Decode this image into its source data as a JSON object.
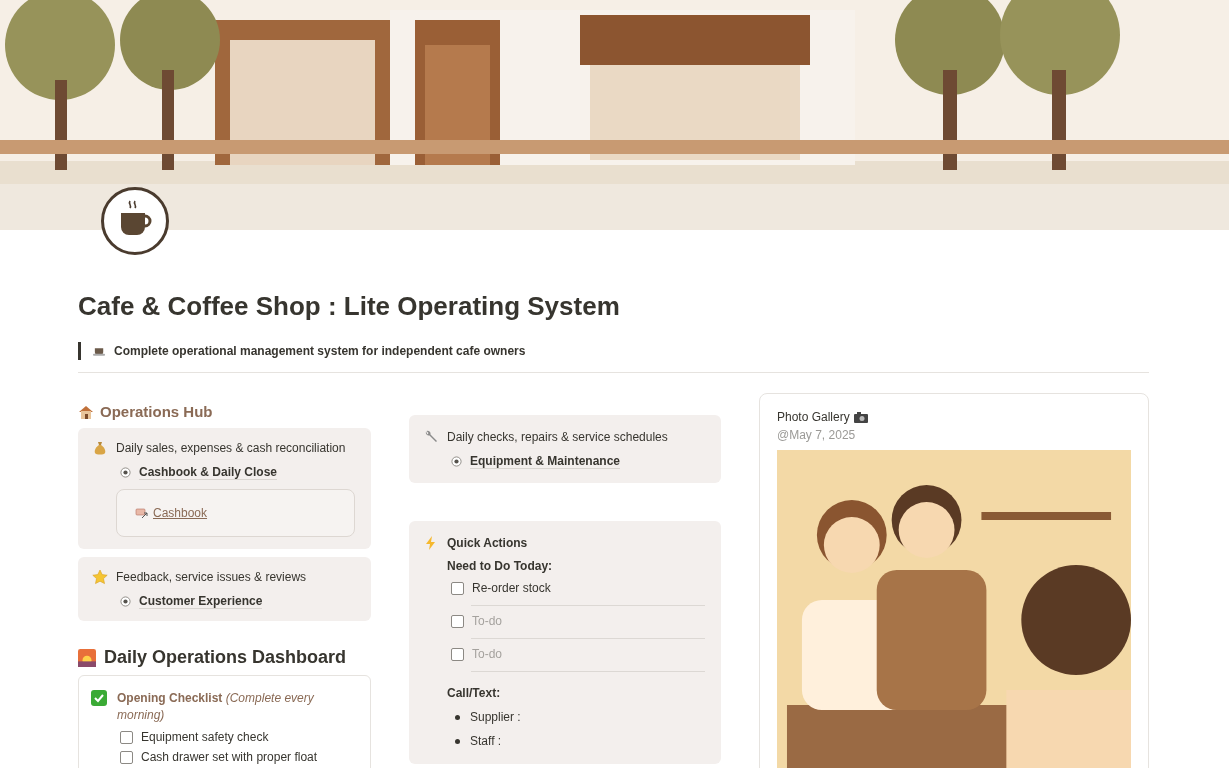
{
  "title": "Cafe & Coffee Shop : Lite Operating System",
  "callout": {
    "text": "Complete operational management system for independent cafe owners"
  },
  "operations_hub": {
    "heading": "Operations Hub",
    "cards": [
      {
        "description": "Daily sales, expenses & cash reconciliation",
        "link": "Cashbook & Daily Close",
        "embed": "Cashbook"
      },
      {
        "description": "Feedback, service issues & reviews",
        "link": "Customer Experience"
      }
    ]
  },
  "maintenance_card": {
    "description": "Daily checks, repairs & service schedules",
    "link": "Equipment & Maintenance"
  },
  "quick_actions": {
    "title": "Quick Actions",
    "todo_heading": "Need to Do Today:",
    "todos": [
      {
        "text": "Re-order stock",
        "checked": false
      },
      {
        "placeholder": "To-do",
        "checked": false
      },
      {
        "placeholder": "To-do",
        "checked": false
      }
    ],
    "contacts_heading": "Call/Text:",
    "contacts": [
      "Supplier :",
      "Staff :"
    ]
  },
  "dashboard": {
    "heading": "Daily Operations Dashboard",
    "checklist_title": "**Opening Checklist** *(Complete every morning)*",
    "items": [
      {
        "text": "Equipment safety check",
        "checked": false
      },
      {
        "text": "Cash drawer set with proper float",
        "checked": false
      }
    ]
  },
  "gallery": {
    "title": "Photo Gallery",
    "date": "@May 7, 2025"
  }
}
